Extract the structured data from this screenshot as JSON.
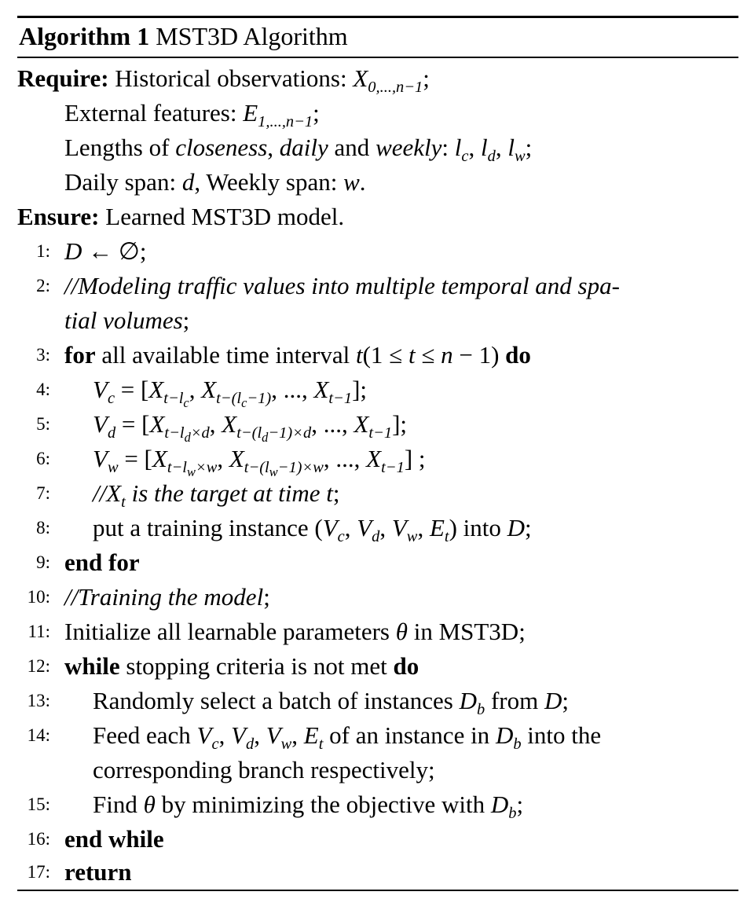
{
  "caption": {
    "label": "Algorithm 1",
    "title": "MST3D Algorithm"
  },
  "require": {
    "label": "Require:",
    "lines": [
      "Historical observations: X0,...,n−1;",
      "External features: E1,...,n−1;",
      "Lengths of closeness, daily and weekly: lc, ld, lw;",
      "Daily span: d, Weekly span: w."
    ]
  },
  "ensure": {
    "label": "Ensure:",
    "text": "Learned MST3D model."
  },
  "steps": [
    {
      "n": "1:",
      "text": "D ← ∅;"
    },
    {
      "n": "2:",
      "text": "//Modeling traffic values into multiple temporal and spa-",
      "cont": "tial volumes;"
    },
    {
      "n": "3:",
      "text": "for all available time interval t(1 ≤ t ≤ n − 1) do"
    },
    {
      "n": "4:",
      "text": "Vc = [Xt−lc, Xt−(lc−1), ..., Xt−1];"
    },
    {
      "n": "5:",
      "text": "Vd = [Xt−ld×d, Xt−(ld−1)×d, ..., Xt−1];"
    },
    {
      "n": "6:",
      "text": "Vw = [Xt−lw×w, Xt−(lw−1)×w, ..., Xt−1] ;"
    },
    {
      "n": "7:",
      "text": "//Xt is the target at time t;"
    },
    {
      "n": "8:",
      "text": "put a training instance (Vc, Vd, Vw, Et) into D;"
    },
    {
      "n": "9:",
      "text": "end for"
    },
    {
      "n": "10:",
      "text": "//Training the model;"
    },
    {
      "n": "11:",
      "text": "Initialize all learnable parameters θ in MST3D;"
    },
    {
      "n": "12:",
      "text": "while stopping criteria is not met do"
    },
    {
      "n": "13:",
      "text": "Randomly select a batch of instances Db from D;"
    },
    {
      "n": "14:",
      "text": "Feed each Vc, Vd, Vw, Et of an instance in Db into the",
      "cont": "corresponding branch respectively;"
    },
    {
      "n": "15:",
      "text": "Find θ by minimizing the objective with Db;"
    },
    {
      "n": "16:",
      "text": "end while"
    },
    {
      "n": "17:",
      "text": "return"
    }
  ]
}
